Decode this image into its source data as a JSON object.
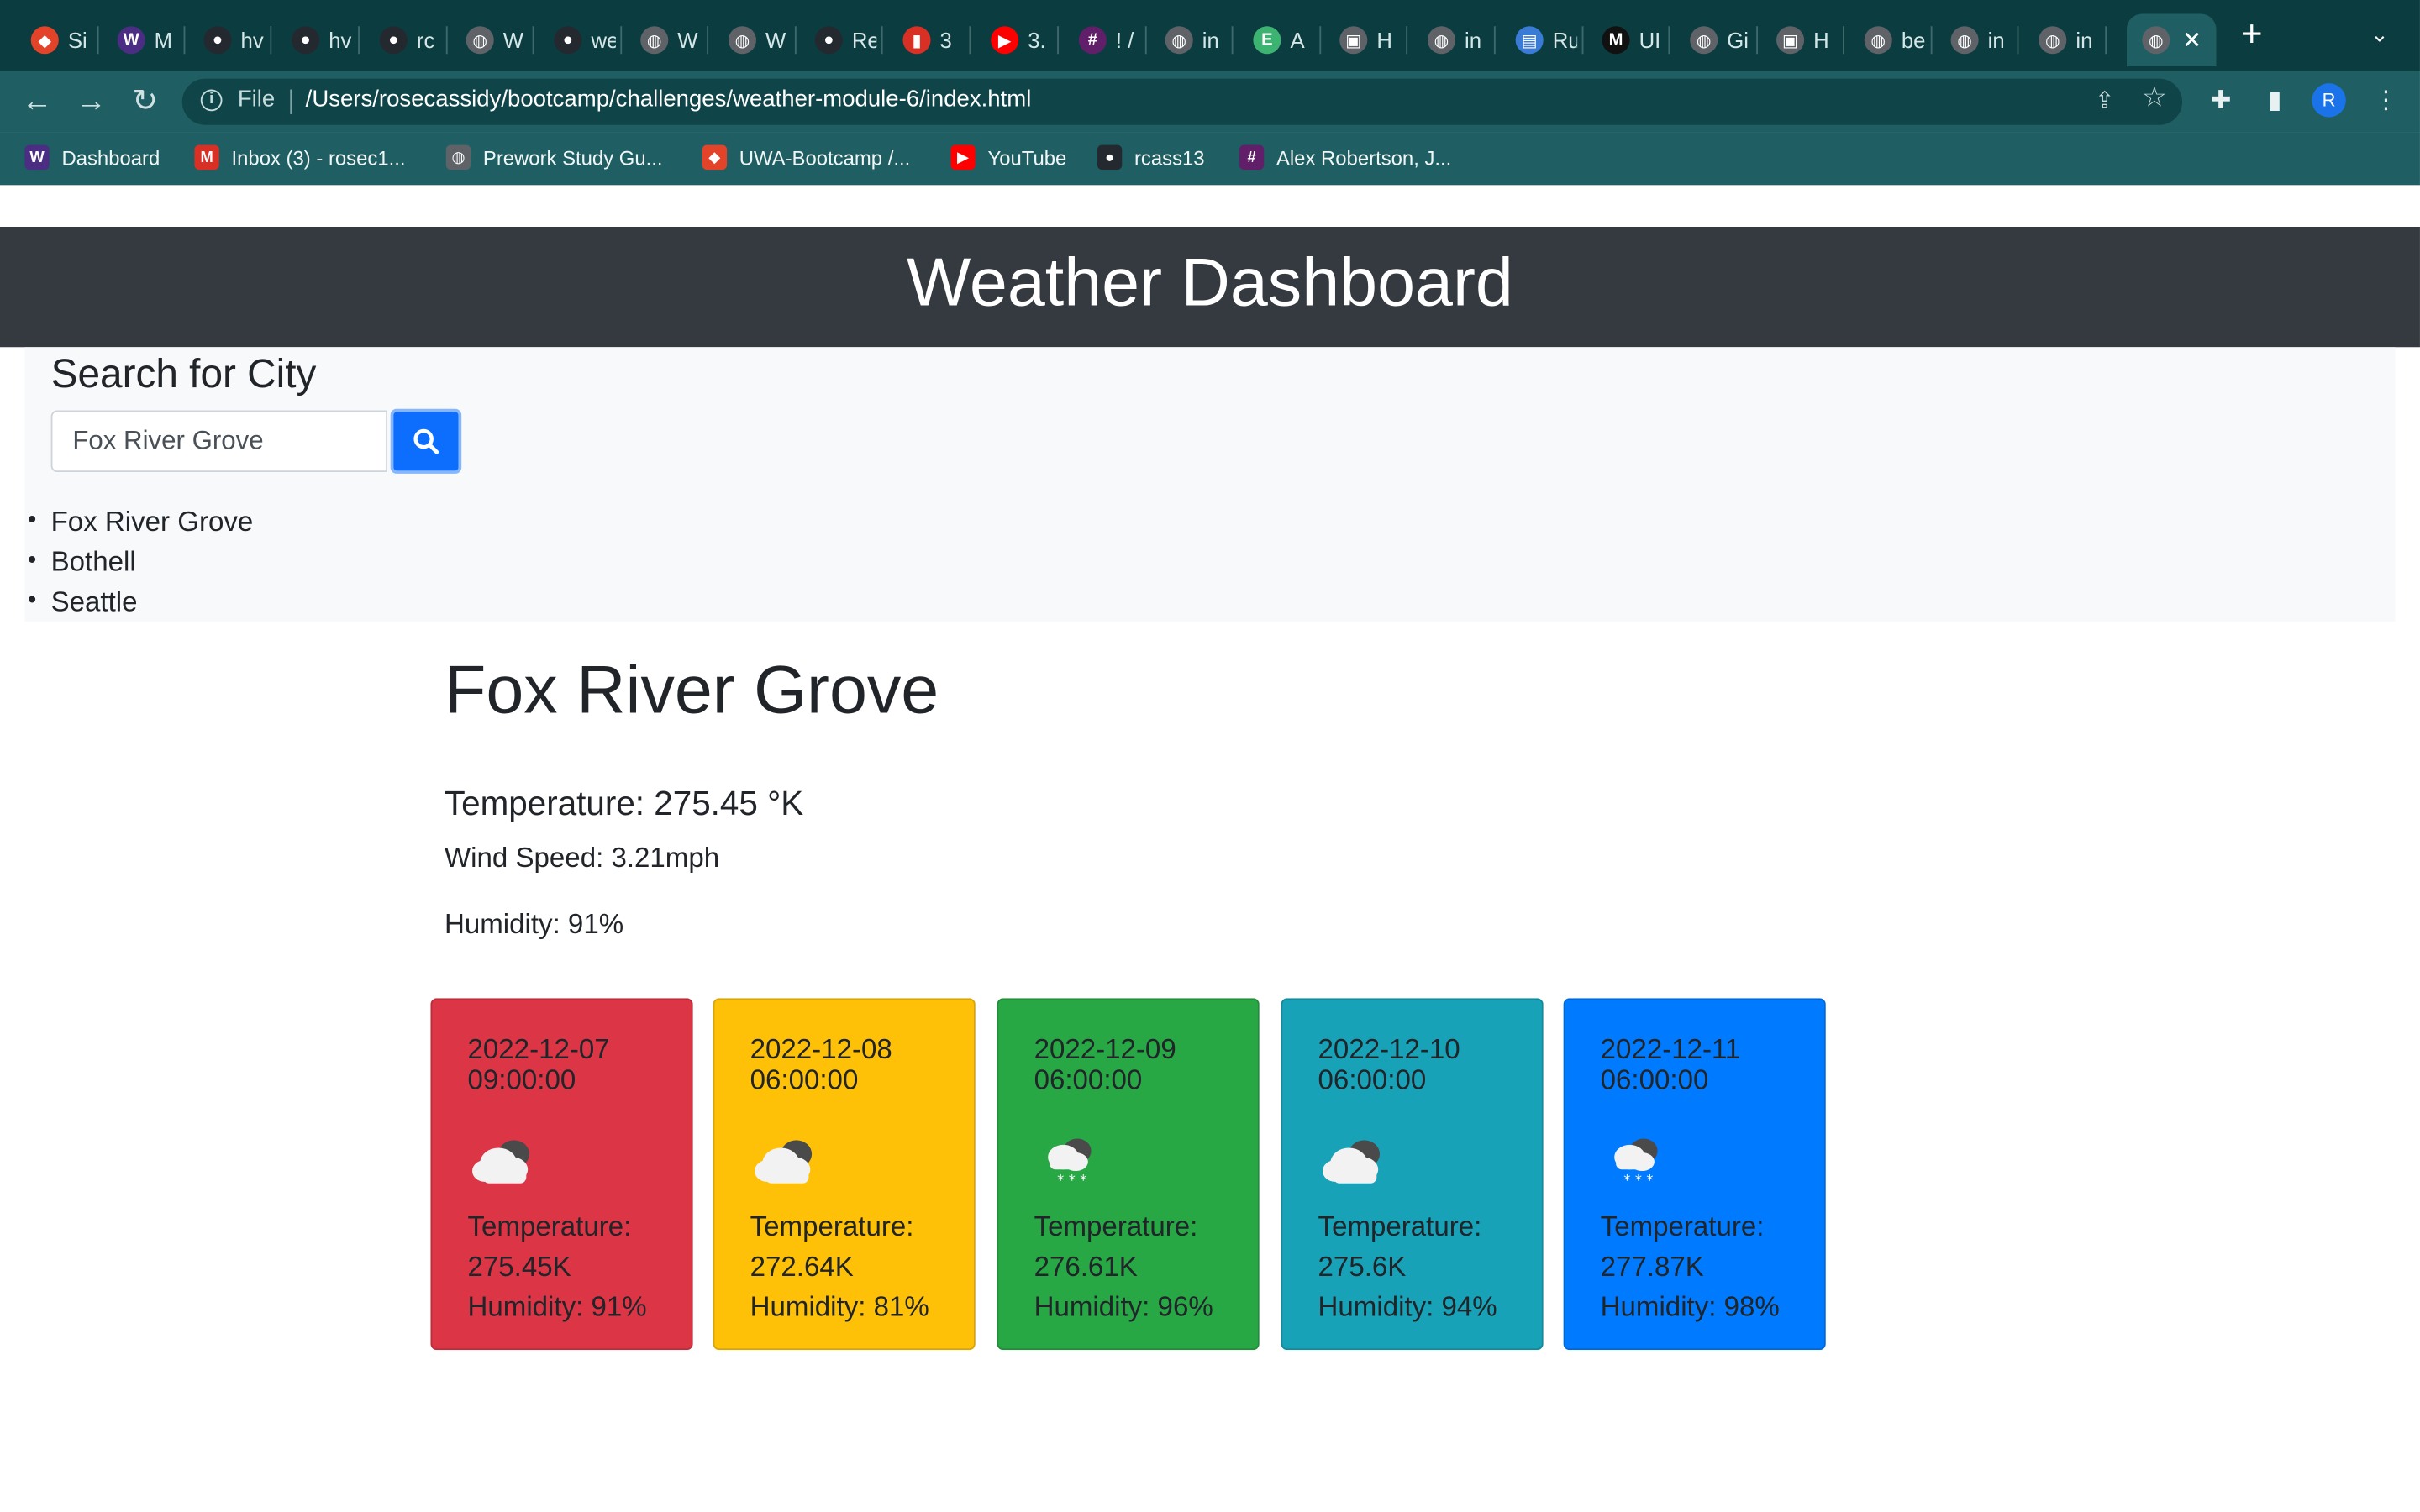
{
  "browser": {
    "tabs": [
      {
        "label": "Si",
        "color": "#e24329",
        "glyph": "◆"
      },
      {
        "label": "M",
        "color": "#4b2e83",
        "glyph": "W"
      },
      {
        "label": "hv",
        "color": "#24292f",
        "glyph": "●"
      },
      {
        "label": "hv",
        "color": "#24292f",
        "glyph": "●"
      },
      {
        "label": "rc",
        "color": "#24292f",
        "glyph": "●"
      },
      {
        "label": "W",
        "color": "#5f6368",
        "glyph": "◍"
      },
      {
        "label": "we",
        "color": "#24292f",
        "glyph": "●"
      },
      {
        "label": "W",
        "color": "#5f6368",
        "glyph": "◍"
      },
      {
        "label": "W",
        "color": "#5f6368",
        "glyph": "◍"
      },
      {
        "label": "Re",
        "color": "#24292f",
        "glyph": "●"
      },
      {
        "label": "3",
        "color": "#d93025",
        "glyph": "▮"
      },
      {
        "label": "3.",
        "color": "#ff0000",
        "glyph": "▶"
      },
      {
        "label": "! /",
        "color": "#611f69",
        "glyph": "#"
      },
      {
        "label": "in",
        "color": "#5f6368",
        "glyph": "◍"
      },
      {
        "label": "A",
        "color": "#3cb371",
        "glyph": "E"
      },
      {
        "label": "H",
        "color": "#5f6368",
        "glyph": "▣"
      },
      {
        "label": "in",
        "color": "#5f6368",
        "glyph": "◍"
      },
      {
        "label": "Ru",
        "color": "#3a7bd5",
        "glyph": "▤"
      },
      {
        "label": "UI",
        "color": "#111111",
        "glyph": "M"
      },
      {
        "label": "Gi",
        "color": "#5f6368",
        "glyph": "◍"
      },
      {
        "label": "H",
        "color": "#5f6368",
        "glyph": "▣"
      },
      {
        "label": "be",
        "color": "#5f6368",
        "glyph": "◍"
      },
      {
        "label": "in",
        "color": "#5f6368",
        "glyph": "◍"
      },
      {
        "label": "in",
        "color": "#5f6368",
        "glyph": "◍"
      }
    ],
    "url_scheme": "File",
    "url": "/Users/rosecassidy/bootcamp/challenges/weather-module-6/index.html",
    "profile_initial": "R",
    "bookmarks": [
      {
        "label": "Dashboard",
        "color": "#4b2e83",
        "glyph": "W"
      },
      {
        "label": "Inbox (3) - rosec1...",
        "color": "#d93025",
        "glyph": "M"
      },
      {
        "label": "Prework Study Gu...",
        "color": "#5f6368",
        "glyph": "◍"
      },
      {
        "label": "UWA-Bootcamp /...",
        "color": "#e24329",
        "glyph": "◆"
      },
      {
        "label": "YouTube",
        "color": "#ff0000",
        "glyph": "▶"
      },
      {
        "label": "rcass13",
        "color": "#24292f",
        "glyph": "●"
      },
      {
        "label": "Alex Robertson, J...",
        "color": "#611f69",
        "glyph": "#"
      }
    ]
  },
  "page": {
    "title": "Weather Dashboard",
    "search": {
      "heading": "Search for City",
      "value": "Fox River Grove"
    },
    "history": [
      "Fox River Grove",
      "Bothell",
      "Seattle"
    ],
    "current": {
      "city": "Fox River Grove",
      "temperature": "Temperature: 275.45 °K",
      "wind": "Wind Speed: 3.21mph",
      "humidity": "Humidity: 91%"
    },
    "forecast_label": "Temperature:",
    "forecast": [
      {
        "date": "2022-12-07 09:00:00",
        "icon": "cloudy-icon",
        "temp": "275.45K",
        "humidity": "Humidity: 91%",
        "color": "#dc3545"
      },
      {
        "date": "2022-12-08 06:00:00",
        "icon": "cloudy-icon",
        "temp": "272.64K",
        "humidity": "Humidity: 81%",
        "color": "#ffc107"
      },
      {
        "date": "2022-12-09 06:00:00",
        "icon": "snow-cloud-icon",
        "temp": "276.61K",
        "humidity": "Humidity: 96%",
        "color": "#28a745"
      },
      {
        "date": "2022-12-10 06:00:00",
        "icon": "cloudy-icon",
        "temp": "275.6K",
        "humidity": "Humidity: 94%",
        "color": "#17a2b8"
      },
      {
        "date": "2022-12-11 06:00:00",
        "icon": "snow-cloud-icon",
        "temp": "277.87K",
        "humidity": "Humidity: 98%",
        "color": "#007bff"
      }
    ]
  }
}
